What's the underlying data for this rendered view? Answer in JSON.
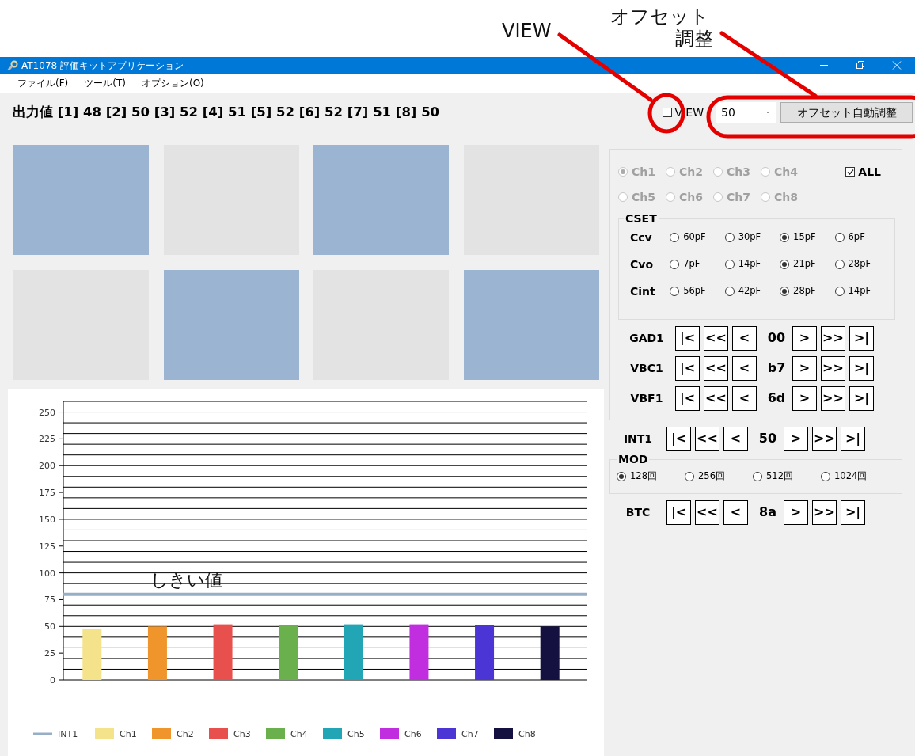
{
  "annotations": [
    {
      "kind": "circle",
      "lines": [
        "VIEW"
      ]
    },
    {
      "kind": "frame",
      "lines": [
        "オフセット",
        "調整"
      ]
    }
  ],
  "window": {
    "title": "AT1078 評価キットアプリケーション"
  },
  "menu": [
    "ファイル(F)",
    "ツール(T)",
    "オプション(O)"
  ],
  "output": {
    "label": "出力値",
    "values": [
      {
        "index": "[1]",
        "value": "48"
      },
      {
        "index": "[2]",
        "value": "50"
      },
      {
        "index": "[3]",
        "value": "52"
      },
      {
        "index": "[4]",
        "value": "51"
      },
      {
        "index": "[5]",
        "value": "52"
      },
      {
        "index": "[6]",
        "value": "52"
      },
      {
        "index": "[7]",
        "value": "51"
      },
      {
        "index": "[8]",
        "value": "50"
      }
    ]
  },
  "view_checkbox": {
    "label": "VIEW",
    "checked": false
  },
  "offset_select": {
    "value": "50"
  },
  "offset_button": "オフセット自動調整",
  "tiles": [
    {
      "on": true
    },
    {
      "on": false
    },
    {
      "on": true
    },
    {
      "on": false
    },
    {
      "on": false
    },
    {
      "on": true
    },
    {
      "on": false
    },
    {
      "on": true
    }
  ],
  "chart_data": {
    "type": "bar",
    "ylim": [
      0,
      260
    ],
    "yticks": [
      0,
      25,
      50,
      75,
      100,
      125,
      150,
      175,
      200,
      225,
      250
    ],
    "stacked": true,
    "series": [
      {
        "name": "INT1",
        "type": "line",
        "color": "#96afc6",
        "values": [
          80,
          80,
          80,
          80,
          80,
          80,
          80,
          80
        ]
      },
      {
        "name": "Ch1",
        "color": "#f5e38c",
        "values": [
          48,
          null,
          null,
          null,
          null,
          null,
          null,
          null
        ]
      },
      {
        "name": "Ch2",
        "color": "#f0952c",
        "values": [
          null,
          50,
          null,
          null,
          null,
          null,
          null,
          null
        ]
      },
      {
        "name": "Ch3",
        "color": "#e8504e",
        "values": [
          null,
          null,
          52,
          null,
          null,
          null,
          null,
          null
        ]
      },
      {
        "name": "Ch4",
        "color": "#6ab04c",
        "values": [
          null,
          null,
          null,
          51,
          null,
          null,
          null,
          null
        ]
      },
      {
        "name": "Ch5",
        "color": "#22a5b4",
        "values": [
          null,
          null,
          null,
          null,
          52,
          null,
          null,
          null
        ]
      },
      {
        "name": "Ch6",
        "color": "#c02edf",
        "values": [
          null,
          null,
          null,
          null,
          null,
          52,
          null,
          null
        ]
      },
      {
        "name": "Ch7",
        "color": "#4b35d4",
        "values": [
          null,
          null,
          null,
          null,
          null,
          null,
          51,
          null
        ]
      },
      {
        "name": "Ch8",
        "color": "#14103f",
        "values": [
          null,
          null,
          null,
          null,
          null,
          null,
          null,
          50
        ]
      }
    ],
    "grid": true,
    "legend": true,
    "annotations": [
      "しきい値"
    ]
  },
  "channel_select": {
    "disabled": true,
    "items": [
      {
        "label": "Ch1",
        "selected": true
      },
      {
        "label": "Ch2",
        "selected": false
      },
      {
        "label": "Ch3",
        "selected": false
      },
      {
        "label": "Ch4",
        "selected": false
      },
      {
        "label": "Ch5",
        "selected": false
      },
      {
        "label": "Ch6",
        "selected": false
      },
      {
        "label": "Ch7",
        "selected": false
      },
      {
        "label": "Ch8",
        "selected": false
      }
    ]
  },
  "all_checkbox": {
    "label": "ALL",
    "checked": true
  },
  "cset": {
    "title": "CSET",
    "rows": [
      {
        "label": "Ccv",
        "options": [
          {
            "label": "60pF",
            "selected": false
          },
          {
            "label": "30pF",
            "selected": false
          },
          {
            "label": "15pF",
            "selected": true
          },
          {
            "label": "6pF",
            "selected": false
          }
        ]
      },
      {
        "label": "Cvo",
        "options": [
          {
            "label": "7pF",
            "selected": false
          },
          {
            "label": "14pF",
            "selected": false
          },
          {
            "label": "21pF",
            "selected": true
          },
          {
            "label": "28pF",
            "selected": false
          }
        ]
      },
      {
        "label": "Cint",
        "options": [
          {
            "label": "56pF",
            "selected": false
          },
          {
            "label": "42pF",
            "selected": false
          },
          {
            "label": "28pF",
            "selected": true
          },
          {
            "label": "14pF",
            "selected": false
          }
        ]
      }
    ]
  },
  "group_steppers": [
    {
      "label": "GAD1",
      "value": "00",
      "back": [
        "|<",
        "<<",
        "<"
      ],
      "forward": [
        ">",
        ">>",
        ">|"
      ]
    },
    {
      "label": "VBC1",
      "value": "b7",
      "back": [
        "|<",
        "<<",
        "<"
      ],
      "forward": [
        ">",
        ">>",
        ">|"
      ]
    },
    {
      "label": "VBF1",
      "value": "6d",
      "back": [
        "|<",
        "<<",
        "<"
      ],
      "forward": [
        ">",
        ">>",
        ">|"
      ]
    }
  ],
  "int_stepper": {
    "label": "INT1",
    "value": "50",
    "back": [
      "|<",
      "<<",
      "<"
    ],
    "forward": [
      ">",
      ">>",
      ">|"
    ]
  },
  "mod": {
    "title": "MOD",
    "options": [
      {
        "label": "128回",
        "selected": true
      },
      {
        "label": "256回",
        "selected": false
      },
      {
        "label": "512回",
        "selected": false
      },
      {
        "label": "1024回",
        "selected": false
      }
    ]
  },
  "btc_stepper": {
    "label": "BTC",
    "value": "8a",
    "back": [
      "|<",
      "<<",
      "<"
    ],
    "forward": [
      ">",
      ">>",
      ">|"
    ]
  }
}
